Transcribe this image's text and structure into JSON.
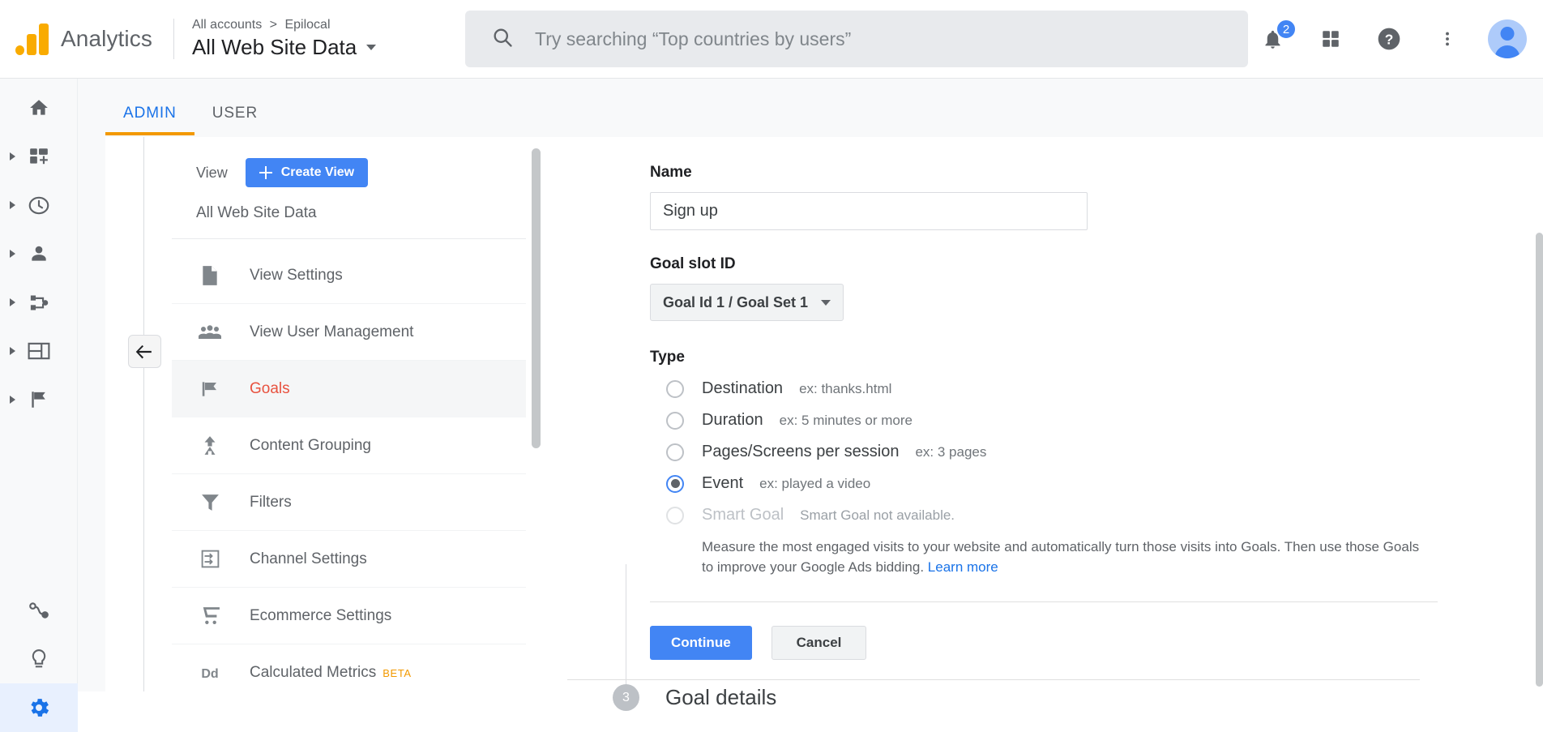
{
  "header": {
    "brand": "Analytics",
    "breadcrumb_account": "All accounts",
    "breadcrumb_separator": ">",
    "breadcrumb_property": "Epilocal",
    "view_title": "All Web Site Data",
    "search_placeholder": "Try searching “Top countries by users”",
    "notification_count": "2",
    "icons": {
      "search": "search-icon",
      "notifications": "bell-icon",
      "apps": "apps-grid-icon",
      "help": "help-icon",
      "more": "more-vert-icon",
      "avatar": "user-avatar"
    }
  },
  "rail": {
    "items": [
      {
        "name": "home",
        "icon": "home-icon",
        "expandable": false,
        "active": false
      },
      {
        "name": "customization",
        "icon": "customization-icon",
        "expandable": true,
        "active": false
      },
      {
        "name": "realtime",
        "icon": "clock-icon",
        "expandable": true,
        "active": false
      },
      {
        "name": "audience",
        "icon": "person-icon",
        "expandable": true,
        "active": false
      },
      {
        "name": "acquisition",
        "icon": "share-nodes-icon",
        "expandable": true,
        "active": false
      },
      {
        "name": "behavior",
        "icon": "window-icon",
        "expandable": true,
        "active": false
      },
      {
        "name": "conversions",
        "icon": "flag-icon",
        "expandable": true,
        "active": false
      },
      {
        "name": "discover",
        "icon": "discover-path-icon",
        "expandable": false,
        "active": false
      },
      {
        "name": "attribution",
        "icon": "lightbulb-icon",
        "expandable": false,
        "active": false
      },
      {
        "name": "admin",
        "icon": "gear-icon",
        "expandable": false,
        "active": true
      }
    ],
    "active_color": "#1a73e8",
    "active_bg": "#e8f0fe"
  },
  "tabs": [
    {
      "label": "ADMIN",
      "active": true
    },
    {
      "label": "USER",
      "active": false
    }
  ],
  "tab_indicator_color": "#f29900",
  "admin_column": {
    "view_label": "View",
    "create_view_button": "Create View",
    "current_view": "All Web Site Data",
    "items": [
      {
        "label": "View Settings",
        "icon": "document-icon",
        "selected": false
      },
      {
        "label": "View User Management",
        "icon": "people-icon",
        "selected": false
      },
      {
        "label": "Goals",
        "icon": "flag-icon",
        "selected": true
      },
      {
        "label": "Content Grouping",
        "icon": "content-grouping-icon",
        "selected": false
      },
      {
        "label": "Filters",
        "icon": "funnel-icon",
        "selected": false
      },
      {
        "label": "Channel Settings",
        "icon": "channel-settings-icon",
        "selected": false
      },
      {
        "label": "Ecommerce Settings",
        "icon": "shopping-cart-icon",
        "selected": false
      },
      {
        "label": "Calculated Metrics",
        "icon": "dd-icon",
        "badge": "BETA",
        "selected": false
      }
    ],
    "selected_color": "#e8523f",
    "badge_color": "#f29900"
  },
  "goal_form": {
    "name_label": "Name",
    "name_value": "Sign up",
    "name_placeholder": "",
    "slot_label": "Goal slot ID",
    "slot_value": "Goal Id 1 / Goal Set 1",
    "type_label": "Type",
    "types": [
      {
        "label": "Destination",
        "example": "ex: thanks.html",
        "selected": false,
        "disabled": false
      },
      {
        "label": "Duration",
        "example": "ex: 5 minutes or more",
        "selected": false,
        "disabled": false
      },
      {
        "label": "Pages/Screens per session",
        "example": "ex: 3 pages",
        "selected": false,
        "disabled": false
      },
      {
        "label": "Event",
        "example": "ex: played a video",
        "selected": true,
        "disabled": false
      },
      {
        "label": "Smart Goal",
        "example": "Smart Goal not available.",
        "selected": false,
        "disabled": true
      }
    ],
    "smart_goal_description": "Measure the most engaged visits to your website and automatically turn those visits into Goals. Then use those Goals to improve your Google Ads bidding.",
    "learn_more": "Learn more",
    "continue_button": "Continue",
    "cancel_button": "Cancel",
    "step_number": "3",
    "step_title": "Goal details",
    "primary_color": "#4285f4"
  }
}
